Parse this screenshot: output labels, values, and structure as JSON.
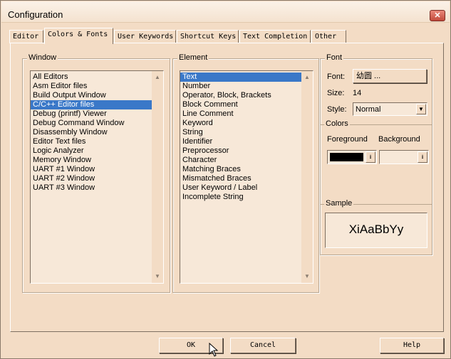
{
  "window": {
    "title": "Configuration",
    "close_glyph": "✕"
  },
  "tabs": [
    {
      "label": "Editor"
    },
    {
      "label": "Colors & Fonts",
      "active": true
    },
    {
      "label": "User Keywords"
    },
    {
      "label": "Shortcut Keys"
    },
    {
      "label": "Text Completion"
    },
    {
      "label": "Other"
    }
  ],
  "window_group": {
    "label": "Window",
    "items": [
      "All Editors",
      "Asm Editor files",
      "Build Output Window",
      "C/C++ Editor files",
      "Debug (printf) Viewer",
      "Debug Command Window",
      "Disassembly Window",
      "Editor Text files",
      "Logic Analyzer",
      "Memory Window",
      "UART #1 Window",
      "UART #2 Window",
      "UART #3 Window"
    ],
    "selected_index": 3
  },
  "element_group": {
    "label": "Element",
    "items": [
      "Text",
      "Number",
      "Operator, Block, Brackets",
      "Block Comment",
      "Line Comment",
      "Keyword",
      "String",
      "Identifier",
      "Preprocessor",
      "Character",
      "Matching Braces",
      "Mismatched Braces",
      "User Keyword / Label",
      "Incomplete String"
    ],
    "selected_index": 0
  },
  "font_group": {
    "label": "Font",
    "font_label": "Font:",
    "font_button": "幼圆 ...",
    "size_label": "Size:",
    "size_value": "14",
    "style_label": "Style:",
    "style_value": "Normal"
  },
  "colors_group": {
    "label": "Colors",
    "foreground_label": "Foreground",
    "background_label": "Background",
    "foreground_color": "#000000",
    "background_color": "#f7e8d8"
  },
  "sample_group": {
    "label": "Sample",
    "sample_text": "XiAaBbYy"
  },
  "buttons": {
    "ok": "OK",
    "cancel": "Cancel",
    "help": "Help"
  },
  "colors": {
    "dialog_bg": "#f3dcc5",
    "selection": "#3a78c8"
  }
}
